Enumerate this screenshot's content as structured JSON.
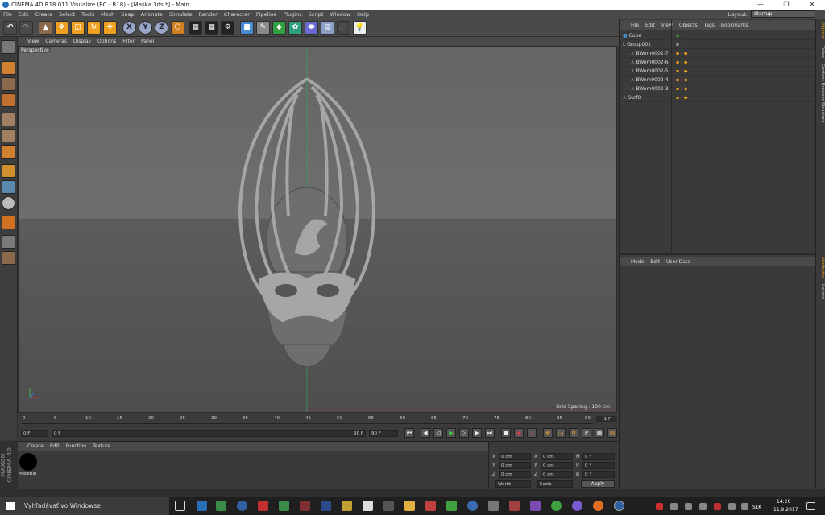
{
  "window": {
    "title": "CINEMA 4D R18.011 Visualize (RC - R18) - [Maska.3ds *] - Main",
    "controls": [
      "—",
      "❐",
      "✕"
    ]
  },
  "menubar": [
    "File",
    "Edit",
    "Create",
    "Select",
    "Tools",
    "Mesh",
    "Snap",
    "Animate",
    "Simulate",
    "Render",
    "Character",
    "Pipeline",
    "Plugins",
    "Script",
    "Window",
    "Help"
  ],
  "layout": {
    "label": "Layout:",
    "value": "Startup"
  },
  "viewport": {
    "menu": [
      "View",
      "Cameras",
      "Display",
      "Options",
      "Filter",
      "Panel"
    ],
    "camera_label": "Perspective",
    "grid_spacing": "Grid Spacing : 100 cm"
  },
  "timeline": {
    "ticks": [
      "0",
      "5",
      "10",
      "15",
      "20",
      "25",
      "30",
      "35",
      "40",
      "45",
      "50",
      "55",
      "60",
      "65",
      "70",
      "75",
      "80",
      "85",
      "90"
    ],
    "current_frame": "0 F",
    "start_field": "0 F",
    "range_start": "0 F",
    "range_end": "90 F",
    "end_field": "90 F",
    "frame_indicator": "-1 F"
  },
  "material_manager": {
    "menu": [
      "Create",
      "Edit",
      "Function",
      "Texture"
    ],
    "material_name": "Material",
    "brand_text": "MAXON CINEMA 4D"
  },
  "coordinates": {
    "rows": [
      {
        "a": "X",
        "av": "0 cm",
        "b": "X",
        "bv": "0 cm",
        "c": "H",
        "cv": "0 °"
      },
      {
        "a": "Y",
        "av": "0 cm",
        "b": "Y",
        "bv": "0 cm",
        "c": "P",
        "cv": "0 °"
      },
      {
        "a": "Z",
        "av": "0 cm",
        "b": "Z",
        "bv": "0 cm",
        "c": "B",
        "cv": "0 °"
      }
    ],
    "mode_world": "World",
    "mode_scale": "Scale",
    "apply": "Apply"
  },
  "object_manager": {
    "menu": [
      "File",
      "Edit",
      "View",
      "Objects",
      "Tags",
      "Bookmarks"
    ],
    "objects": [
      {
        "name": "Cube",
        "indent": 0
      },
      {
        "name": "Group001",
        "indent": 0
      },
      {
        "name": "BWom0002-7",
        "indent": 1
      },
      {
        "name": "BWom0002-6",
        "indent": 1
      },
      {
        "name": "BWom0002-5",
        "indent": 1
      },
      {
        "name": "BWom0002-4",
        "indent": 1
      },
      {
        "name": "BWom0002-3",
        "indent": 1
      },
      {
        "name": "Surf0",
        "indent": 0
      }
    ]
  },
  "attribute_manager": {
    "menu": [
      "Mode",
      "Edit",
      "User Data"
    ]
  },
  "right_tabs_top": [
    "Objects",
    "Takes",
    "Content Browser",
    "Structure"
  ],
  "right_tabs_bottom": [
    "Attributes",
    "Layers"
  ],
  "taskbar": {
    "search_placeholder": "Vyhľadávať vo Windowse",
    "language": "SLK",
    "time": "14:20",
    "date": "11.9.2017"
  },
  "colors": {
    "accent": "#f0a020",
    "selection": "#2a6fb5",
    "viewport_sky": "#656565",
    "viewport_floor": "#4e4e4e"
  }
}
